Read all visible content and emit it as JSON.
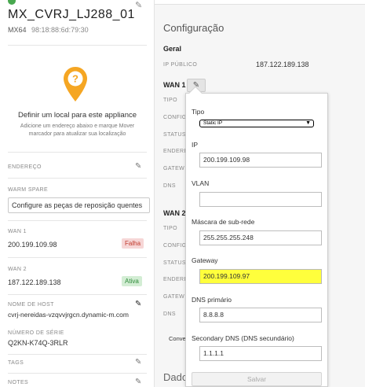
{
  "device": {
    "name": "MX_CVRJ_LJ288_01",
    "model": "MX64",
    "mac": "98:18:88:6d:79:30"
  },
  "location": {
    "title": "Definir um local para este appliance",
    "description": "Adicione um endereço abaixo e marque Mover marcador para atualizar sua localização"
  },
  "left": {
    "address_label": "ENDEREÇO",
    "warm_spare_label": "WARM SPARE",
    "warm_spare_button": "Configure as peças de reposição quentes",
    "wan1_label": "WAN 1",
    "wan1_ip": "200.199.109.98",
    "wan1_status": "Falha",
    "wan2_label": "WAN 2",
    "wan2_ip": "187.122.189.138",
    "wan2_status": "Ativa",
    "hostname_label": "NOME DE HOST",
    "hostname": "cvrj-nereidas-vzqvvjrgcn.dynamic-m.com",
    "serial_label": "NÚMERO DE SÉRIE",
    "serial": "Q2KN-K74Q-3RLR",
    "tags_label": "TAGS",
    "notes_label": "NOTES"
  },
  "config": {
    "title": "Configuração",
    "general": "Geral",
    "public_ip_label": "IP PÚBLICO",
    "public_ip": "187.122.189.138",
    "wan1_heading": "WAN 1",
    "wan2_heading": "WAN 2",
    "row_labels": {
      "tipo": "TIPO",
      "config": "CONFIG",
      "status": "STATUS",
      "endereco": "ENDERE",
      "gateway": "GATEW",
      "dns": "DNS"
    },
    "conv_text": "Conve",
    "data_title": "Dado"
  },
  "form": {
    "tipo_label": "Tipo",
    "tipo_value": "Static IP",
    "ip_label": "IP",
    "ip_value": "200.199.109.98",
    "vlan_label": "VLAN",
    "vlan_value": "",
    "mask_label": "Máscara de sub-rede",
    "mask_value": "255.255.255.248",
    "gateway_label": "Gateway",
    "gateway_value": "200.199.109.97",
    "dns1_label": "DNS primário",
    "dns1_value": "8.8.8.8",
    "dns2_label": "Secondary DNS (DNS secundário)",
    "dns2_value": "1.1.1.1",
    "save_label": "Salvar"
  },
  "colors": {
    "highlight": "#ffff3c",
    "pin": "#f5a623",
    "ok": "#2e8b3a",
    "fail": "#c0392b"
  }
}
